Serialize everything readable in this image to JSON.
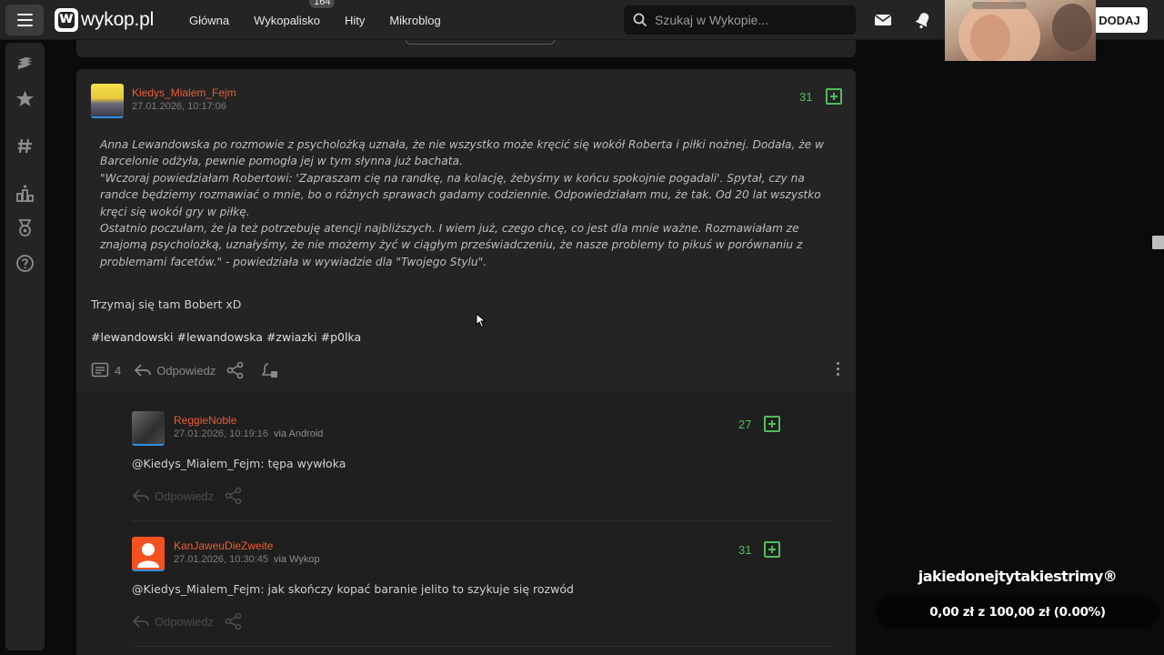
{
  "header": {
    "logo_text": "wykop.pl",
    "nav": [
      {
        "label": "Główna"
      },
      {
        "label": "Wykopalisko",
        "badge": "164"
      },
      {
        "label": "Hity"
      },
      {
        "label": "Mikroblog"
      }
    ],
    "search_placeholder": "Szukaj w Wykopie...",
    "add_button": "DODAJ"
  },
  "post": {
    "author": "Kiedys_Mialem_Fejm",
    "date": "27.01.2026, 10:17:06",
    "votes": "31",
    "quote_paragraphs": [
      "Anna Lewandowska po rozmowie z psycholożką uznała, że nie wszystko może kręcić się wokół Roberta i piłki nożnej. Dodała, że w Barcelonie odżyła, pewnie pomogła jej w tym słynna już bachata.",
      "\"Wczoraj powiedziałam Robertowi: 'Zapraszam cię na randkę, na kolację, żebyśmy w końcu spokojnie pogadali'. Spytał, czy na randce będziemy rozmawiać o mnie, bo o różnych sprawach gadamy codziennie. Odpowiedziałam mu, że tak. Od 20 lat wszystko kręci się wokół gry w piłkę.",
      "Ostatnio poczułam, że ja też potrzebuję atencji najbliższych. I wiem już, czego chcę, co jest dla mnie ważne. Rozmawiałam ze znajomą psycholożką, uznałyśmy, że nie możemy żyć w ciągłym przeświadczeniu, że nasze problemy to pikuś w porównaniu z problemami facetów.\" - powiedziała w wywiadzie dla \"Twojego Stylu\"."
    ],
    "body": "Trzymaj się tam Bobert xD",
    "tags": [
      "#lewandowski",
      "#lewandowska",
      "#zwiazki",
      "#p0lka"
    ],
    "comments_count": "4",
    "reply_label": "Odpowiedz"
  },
  "replies": [
    {
      "author": "ReggieNoble",
      "date": "27.01.2026, 10:19:16",
      "via": "via Android",
      "votes": "27",
      "mention": "@Kiedys_Mialem_Fejm",
      "text": ": tępa wywłoka",
      "reply_label": "Odpowiedz"
    },
    {
      "author": "KanJaweuDieZweite",
      "date": "27.01.2026, 10:30:45",
      "via": "via Wykop",
      "votes": "31",
      "mention": "@Kiedys_Mialem_Fejm",
      "text": ": jak skończy kopać baranie jelito to szykuje się rozwód",
      "reply_label": "Odpowiedz"
    }
  ],
  "overlay": {
    "title": "jakiedonejtytakiestrimy®",
    "progress_text": "0,00 zł z 100,00 zł (0.00%)",
    "progress_fraction": 0.0
  },
  "colors": {
    "accent_author": "#e95d32",
    "vote_green": "#4fbc5c",
    "card_bg": "#242424"
  }
}
